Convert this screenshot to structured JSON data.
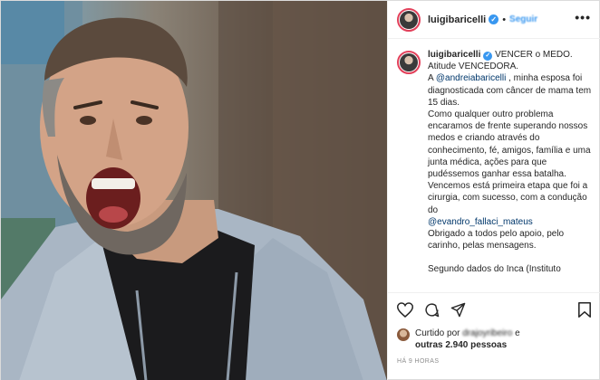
{
  "post": {
    "username": "luigibaricelli",
    "verified_mark": "✓",
    "separator": "•",
    "follow_label": "Seguir",
    "more_options": "•••"
  },
  "caption": {
    "username": "luigibaricelli",
    "lines": [
      "VENCER o MEDO.",
      "Atitude VENCEDORA.",
      "A ",
      "@andreiabaricelli",
      " , minha esposa foi diagnosticada com câncer de mama tem 15 dias.",
      "Como qualquer outro problema encaramos de frente superando nossos medos e criando através do conhecimento, fé, amigos, família e uma junta médica, ações para que pudéssemos ganhar essa batalha.",
      "Vencemos está primeira etapa que foi a cirurgia, com sucesso, com a condução do",
      "@evandro_fallaci_mateus",
      "Obrigado a todos pelo apoio, pelo carinho, pelas mensagens.",
      "Segundo dados do Inca (Instituto"
    ]
  },
  "actions": {
    "like_icon": "heart-icon",
    "comment_icon": "comment-icon",
    "share_icon": "share-icon",
    "save_icon": "bookmark-icon"
  },
  "likes": {
    "prefix": "Curtido por",
    "user": "drajoyribeiro",
    "connector": "e",
    "others": "outras 2.940 pessoas"
  },
  "timestamp": "HÁ 9 HORAS",
  "colors": {
    "link": "#00376b",
    "follow": "#3897f0",
    "verified": "#3897f0",
    "story_ring": "#e2405a"
  }
}
